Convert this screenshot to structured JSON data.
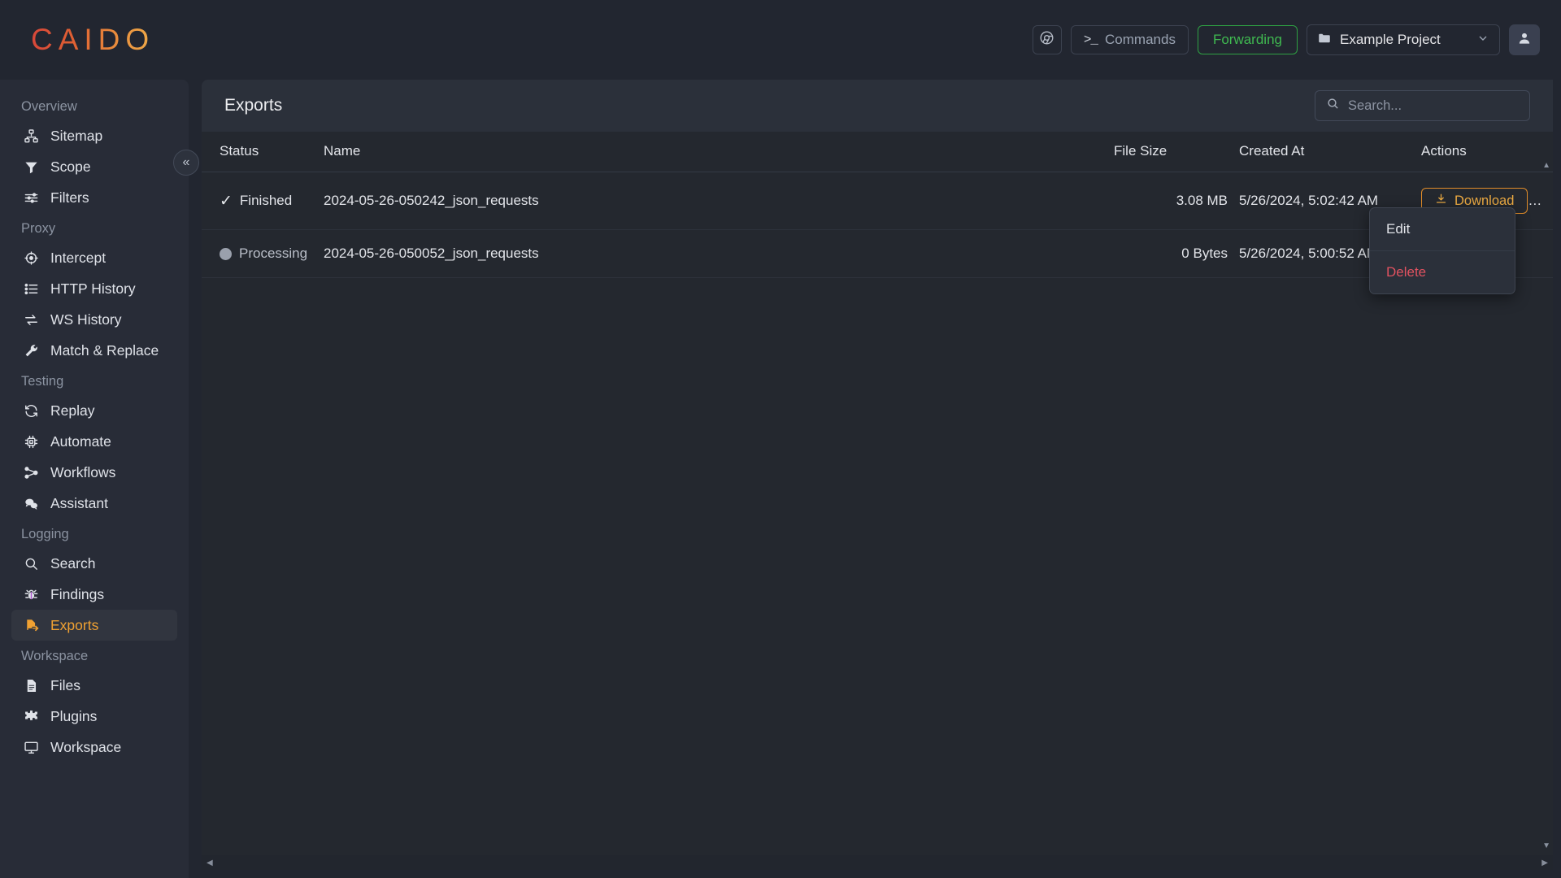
{
  "app": {
    "logo_text": "CAIDO"
  },
  "header": {
    "browser_icon": "chrome-icon",
    "commands_label": "Commands",
    "commands_prompt": ">_",
    "forwarding_label": "Forwarding",
    "project_label": "Example Project",
    "avatar_icon": "user-icon",
    "colors": {
      "forwarding": "#3fb950",
      "accent": "#edab43",
      "danger": "#e05260"
    }
  },
  "sidebar": {
    "collapse_icon": "chevron-double-left-icon",
    "sections": [
      {
        "title": "Overview",
        "items": [
          {
            "label": "Sitemap",
            "icon": "sitemap-icon",
            "active": false
          },
          {
            "label": "Scope",
            "icon": "funnel-icon",
            "active": false
          },
          {
            "label": "Filters",
            "icon": "sliders-icon",
            "active": false
          }
        ]
      },
      {
        "title": "Proxy",
        "items": [
          {
            "label": "Intercept",
            "icon": "crosshair-icon",
            "active": false
          },
          {
            "label": "HTTP History",
            "icon": "list-icon",
            "active": false
          },
          {
            "label": "WS History",
            "icon": "exchange-arrows-icon",
            "active": false
          },
          {
            "label": "Match & Replace",
            "icon": "wrench-icon",
            "active": false
          }
        ]
      },
      {
        "title": "Testing",
        "items": [
          {
            "label": "Replay",
            "icon": "refresh-icon",
            "active": false
          },
          {
            "label": "Automate",
            "icon": "chip-icon",
            "active": false
          },
          {
            "label": "Workflows",
            "icon": "workflow-nodes-icon",
            "active": false
          },
          {
            "label": "Assistant",
            "icon": "chat-bubbles-icon",
            "active": false
          }
        ]
      },
      {
        "title": "Logging",
        "items": [
          {
            "label": "Search",
            "icon": "magnifier-icon",
            "active": false
          },
          {
            "label": "Findings",
            "icon": "bug-icon",
            "active": false
          },
          {
            "label": "Exports",
            "icon": "file-export-icon",
            "active": true
          }
        ]
      },
      {
        "title": "Workspace",
        "items": [
          {
            "label": "Files",
            "icon": "file-icon",
            "active": false
          },
          {
            "label": "Plugins",
            "icon": "puzzle-icon",
            "active": false
          },
          {
            "label": "Workspace",
            "icon": "monitor-icon",
            "active": false
          }
        ]
      }
    ]
  },
  "main": {
    "page_title": "Exports",
    "search": {
      "placeholder": "Search...",
      "value": "",
      "icon": "search-icon"
    },
    "table": {
      "columns": [
        "Status",
        "Name",
        "File Size",
        "Created At",
        "Actions"
      ],
      "rows": [
        {
          "status": "Finished",
          "status_icon": "check-icon",
          "name": "2024-05-26-050242_json_requests",
          "file_size": "3.08 MB",
          "created_at": "5/26/2024, 5:02:42 AM",
          "download_label": "Download",
          "download_icon": "download-icon",
          "kebab_icon": "vertical-dots-icon"
        },
        {
          "status": "Processing",
          "status_icon": "spinner-dot-icon",
          "name": "2024-05-26-050052_json_requests",
          "file_size": "0 Bytes",
          "created_at": "5/26/2024, 5:00:52 AM",
          "download_label": "",
          "download_icon": "",
          "kebab_icon": ""
        }
      ]
    },
    "context_menu": {
      "visible": true,
      "items": [
        {
          "label": "Edit",
          "danger": false
        },
        {
          "label": "Delete",
          "danger": true
        }
      ]
    }
  }
}
